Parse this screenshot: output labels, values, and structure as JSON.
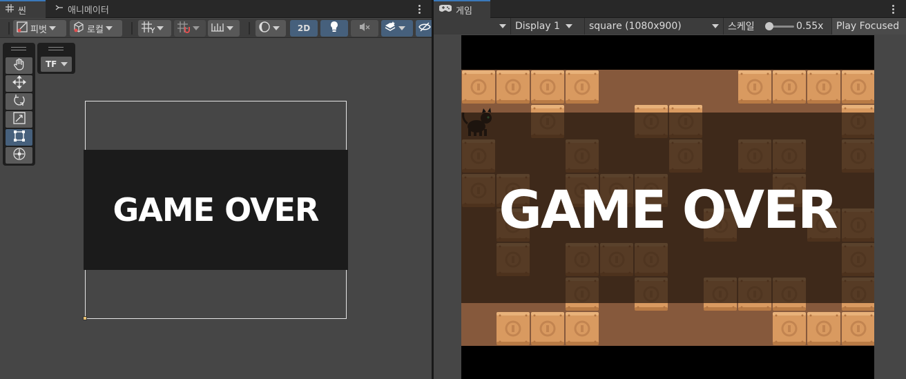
{
  "scene": {
    "tabs": [
      {
        "label": "씬",
        "icon": "grid-icon"
      },
      {
        "label": "애니메이터",
        "icon": "animator-icon"
      }
    ],
    "toolbar": {
      "pivot_label": "피벗",
      "local_label": "로컬",
      "mode_2d_label": "2D"
    },
    "tf_label": "TF",
    "game_over_text": "GAME OVER"
  },
  "game": {
    "tab_label": "게임",
    "tab_icon": "gamepad-icon",
    "display_label": "Display 1",
    "resolution_label": "square (1080x900)",
    "scale_label": "스케일",
    "scale_value": "0.55x",
    "play_focused_label": "Play Focused",
    "game_over_text": "GAME OVER"
  },
  "colors": {
    "accent_blue": "#46607c",
    "tile_orange": "#d99a60",
    "floor_brown": "#86593c",
    "dark_overlay": "#2a1b12"
  }
}
